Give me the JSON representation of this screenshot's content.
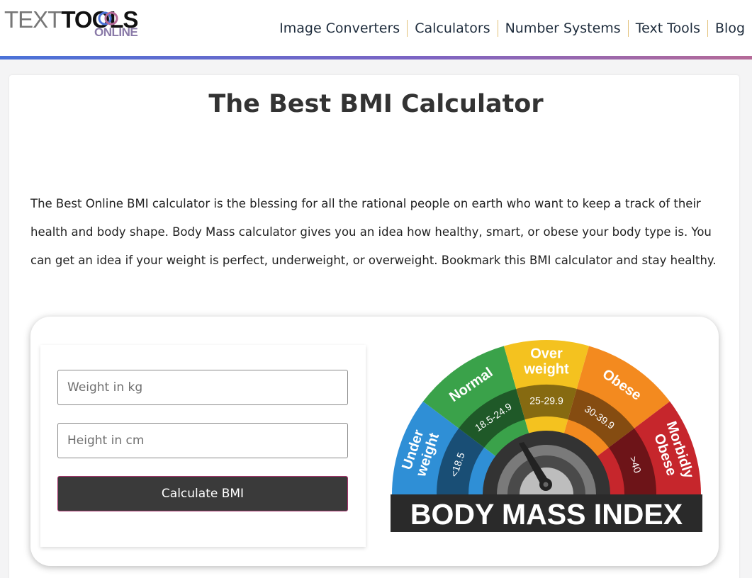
{
  "logo": {
    "part1": "TEXT",
    "part2": "TOOLS",
    "sub": "ONLINE"
  },
  "nav": {
    "items": [
      "Image Converters",
      "Calculators",
      "Number Systems",
      "Text Tools",
      "Blog"
    ]
  },
  "page": {
    "title": "The Best BMI Calculator",
    "intro": "The Best Online BMI calculator is the blessing for all the rational people on earth who want to keep a track of their health and body shape. Body Mass calculator gives you an idea how healthy, smart, or obese your body type is. You can get an idea if your weight is perfect, underweight, or overweight. Bookmark this BMI calculator and stay healthy."
  },
  "form": {
    "weight_placeholder": "Weight in kg",
    "height_placeholder": "Height in cm",
    "button": "Calculate BMI"
  },
  "gauge": {
    "banner": "BODY MASS INDEX",
    "segments": [
      {
        "label": [
          "Under",
          "weight"
        ],
        "range": "<18.5",
        "color": "#2f8fd6"
      },
      {
        "label": [
          "Normal"
        ],
        "range": "18.5-24.9",
        "color": "#3aa24a"
      },
      {
        "label": [
          "Over",
          "weight"
        ],
        "range": "25-29.9",
        "color": "#f4c21f"
      },
      {
        "label": [
          "Obese"
        ],
        "range": "30-39.9",
        "color": "#f38a1f"
      },
      {
        "label": [
          "Morbidly",
          "Obese"
        ],
        "range": ">40",
        "color": "#c6262c"
      }
    ]
  },
  "colors": {
    "nav_text": "#1f2d3d",
    "button_bg": "#3a3a3a",
    "accent_gradient": [
      "#4a72d8",
      "#b56a98"
    ]
  }
}
